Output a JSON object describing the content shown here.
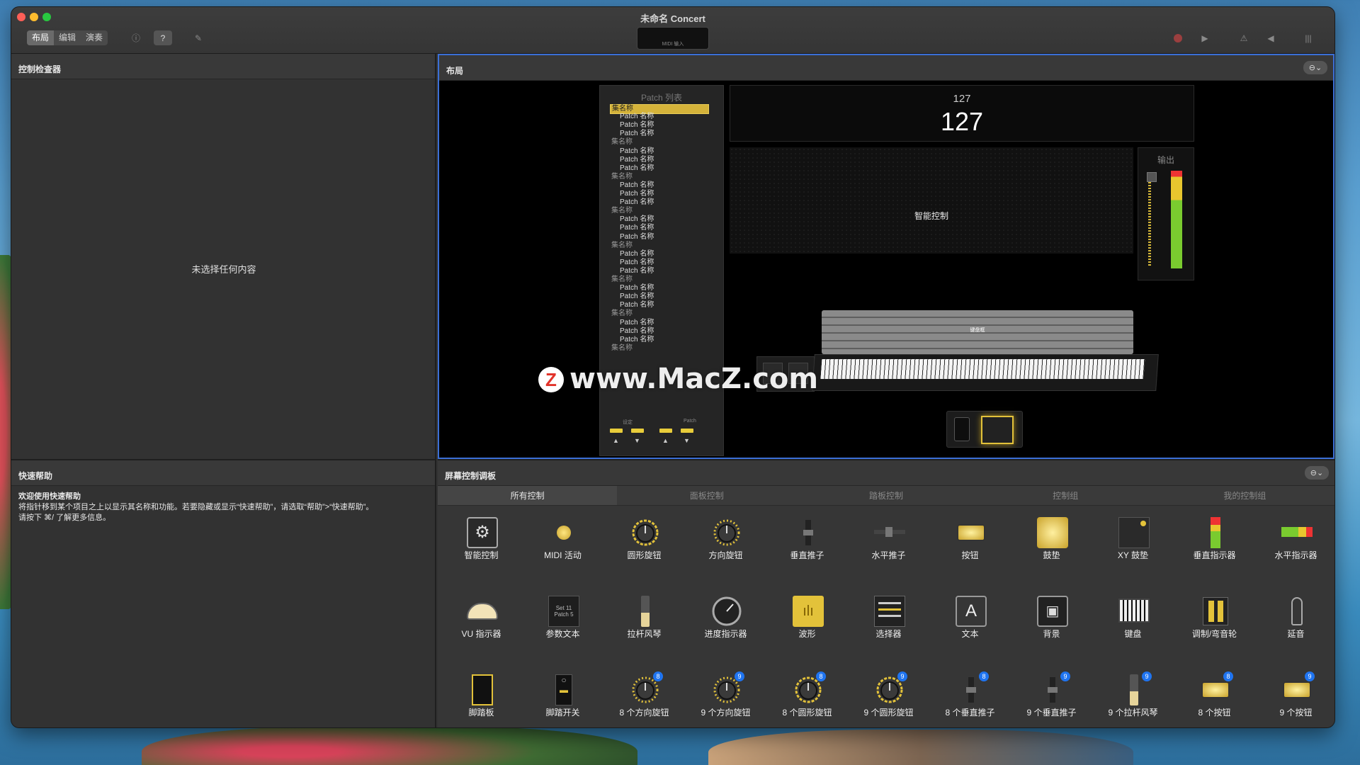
{
  "window": {
    "title": "未命名 Concert",
    "lcd_label": "MIDI 输入"
  },
  "toolbar": {
    "segments": [
      "布局",
      "编辑",
      "演奏"
    ],
    "info_icon": "info-icon",
    "help_icon": "help-icon",
    "wrench_icon": "wrench-icon"
  },
  "inspector": {
    "title": "控制检查器",
    "empty": "未选择任何内容"
  },
  "help": {
    "title": "快速帮助",
    "line1": "欢迎使用快速帮助",
    "line2": "将指针移到某个项目之上以显示其名称和功能。若要隐藏或显示“快速帮助”，请选取“帮助”>“快速帮助”。",
    "line3": "请按下 ⌘/ 了解更多信息。"
  },
  "layout": {
    "title": "布局",
    "patch_list_title": "Patch 列表",
    "patch_items": [
      {
        "t": "集名称",
        "k": "sel"
      },
      {
        "t": "Patch 名称",
        "k": "p"
      },
      {
        "t": "Patch 名称",
        "k": "p"
      },
      {
        "t": "Patch 名称",
        "k": "p"
      },
      {
        "t": "集名称",
        "k": "set"
      },
      {
        "t": "Patch 名称",
        "k": "p"
      },
      {
        "t": "Patch 名称",
        "k": "p"
      },
      {
        "t": "Patch 名称",
        "k": "p"
      },
      {
        "t": "集名称",
        "k": "set"
      },
      {
        "t": "Patch 名称",
        "k": "p"
      },
      {
        "t": "Patch 名称",
        "k": "p"
      },
      {
        "t": "Patch 名称",
        "k": "p"
      },
      {
        "t": "集名称",
        "k": "set"
      },
      {
        "t": "Patch 名称",
        "k": "p"
      },
      {
        "t": "Patch 名称",
        "k": "p"
      },
      {
        "t": "Patch 名称",
        "k": "p"
      },
      {
        "t": "集名称",
        "k": "set"
      },
      {
        "t": "Patch 名称",
        "k": "p"
      },
      {
        "t": "Patch 名称",
        "k": "p"
      },
      {
        "t": "Patch 名称",
        "k": "p"
      },
      {
        "t": "集名称",
        "k": "set"
      },
      {
        "t": "Patch 名称",
        "k": "p"
      },
      {
        "t": "Patch 名称",
        "k": "p"
      },
      {
        "t": "Patch 名称",
        "k": "p"
      },
      {
        "t": "集名称",
        "k": "set"
      },
      {
        "t": "Patch 名称",
        "k": "p"
      },
      {
        "t": "Patch 名称",
        "k": "p"
      },
      {
        "t": "Patch 名称",
        "k": "p"
      },
      {
        "t": "集名称",
        "k": "set"
      }
    ],
    "set_label": "设定",
    "patch_label": "Patch",
    "display_small": "127",
    "display_large": "127",
    "smart_control": "智能控制",
    "output_label": "输出",
    "keyboard_label": "键盘框"
  },
  "watermark": {
    "text": "www.MacZ.com",
    "logo": "Z"
  },
  "screen_controls": {
    "title": "屏幕控制调板",
    "tabs": [
      "所有控制",
      "面板控制",
      "踏板控制",
      "控制组",
      "我的控制组"
    ],
    "items": [
      {
        "label": "智能控制",
        "icon": "smart-control-icon"
      },
      {
        "label": "MIDI 活动",
        "icon": "midi-activity-icon"
      },
      {
        "label": "圆形旋钮",
        "icon": "round-knob-icon"
      },
      {
        "label": "方向旋钮",
        "icon": "direction-knob-icon"
      },
      {
        "label": "垂直推子",
        "icon": "vertical-fader-icon"
      },
      {
        "label": "水平推子",
        "icon": "horizontal-fader-icon"
      },
      {
        "label": "按钮",
        "icon": "button-icon"
      },
      {
        "label": "鼓垫",
        "icon": "drum-pad-icon"
      },
      {
        "label": "XY 鼓垫",
        "icon": "xy-pad-icon"
      },
      {
        "label": "垂直指示器",
        "icon": "vertical-meter-icon"
      },
      {
        "label": "水平指示器",
        "icon": "horizontal-meter-icon"
      },
      {
        "label": "VU 指示器",
        "icon": "vu-meter-icon"
      },
      {
        "label": "参数文本",
        "icon": "parameter-text-icon",
        "mini1": "Set 11",
        "mini2": "Patch 5"
      },
      {
        "label": "拉杆风琴",
        "icon": "drawbar-icon"
      },
      {
        "label": "进度指示器",
        "icon": "progress-indicator-icon"
      },
      {
        "label": "波形",
        "icon": "waveform-icon"
      },
      {
        "label": "选择器",
        "icon": "selector-icon"
      },
      {
        "label": "文本",
        "icon": "text-icon",
        "glyph": "A"
      },
      {
        "label": "背景",
        "icon": "background-image-icon"
      },
      {
        "label": "键盘",
        "icon": "keyboard-icon"
      },
      {
        "label": "调制/弯音轮",
        "icon": "mod-pitch-wheel-icon"
      },
      {
        "label": "延音",
        "icon": "sustain-icon"
      },
      {
        "label": "脚踏板",
        "icon": "foot-pedal-icon"
      },
      {
        "label": "脚踏开关",
        "icon": "foot-switch-icon"
      },
      {
        "label": "8 个方向旋钮",
        "icon": "direction-knob-icon",
        "badge": "8"
      },
      {
        "label": "9 个方向旋钮",
        "icon": "direction-knob-icon",
        "badge": "9"
      },
      {
        "label": "8 个圆形旋钮",
        "icon": "round-knob-icon",
        "badge": "8"
      },
      {
        "label": "9 个圆形旋钮",
        "icon": "round-knob-icon",
        "badge": "9"
      },
      {
        "label": "8 个垂直推子",
        "icon": "vertical-fader-icon",
        "badge": "8"
      },
      {
        "label": "9 个垂直推子",
        "icon": "vertical-fader-icon",
        "badge": "9"
      },
      {
        "label": "9 个拉杆风琴",
        "icon": "drawbar-icon",
        "badge": "9"
      },
      {
        "label": "8 个按钮",
        "icon": "button-icon",
        "badge": "8"
      },
      {
        "label": "9 个按钮",
        "icon": "button-icon",
        "badge": "9"
      }
    ]
  }
}
